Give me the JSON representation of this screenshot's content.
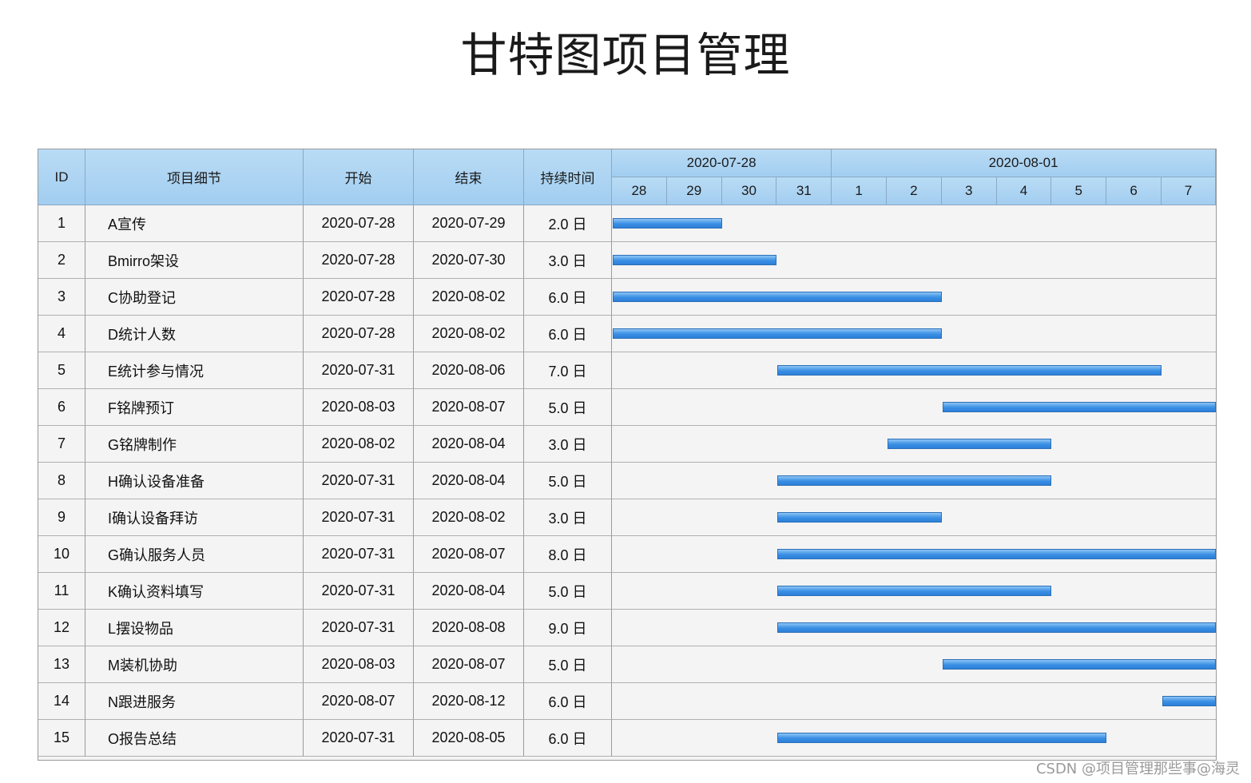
{
  "title": "甘特图项目管理",
  "columns": {
    "id": "ID",
    "detail": "项目细节",
    "start": "开始",
    "end": "结束",
    "duration": "持续时间"
  },
  "timeline": {
    "groups": [
      {
        "label": "2020-07-28",
        "days": 4
      },
      {
        "label": "2020-08-01",
        "days": 7
      }
    ],
    "day_labels": [
      "28",
      "29",
      "30",
      "31",
      "1",
      "2",
      "3",
      "4",
      "5",
      "6",
      "7"
    ],
    "start_date": "2020-07-28"
  },
  "colors": {
    "header": "#a8d1f1",
    "bar": "#3a8fe4",
    "bar_border": "#2c6fb7",
    "row_bg": "#f4f4f4"
  },
  "tasks": [
    {
      "id": "1",
      "name": "A宣传",
      "start": "2020-07-28",
      "end": "2020-07-29",
      "duration": "2.0 日"
    },
    {
      "id": "2",
      "name": "Bmirro架设",
      "start": "2020-07-28",
      "end": "2020-07-30",
      "duration": "3.0 日"
    },
    {
      "id": "3",
      "name": "C协助登记",
      "start": "2020-07-28",
      "end": "2020-08-02",
      "duration": "6.0 日"
    },
    {
      "id": "4",
      "name": "D统计人数",
      "start": "2020-07-28",
      "end": "2020-08-02",
      "duration": "6.0 日"
    },
    {
      "id": "5",
      "name": "E统计参与情况",
      "start": "2020-07-31",
      "end": "2020-08-06",
      "duration": "7.0 日"
    },
    {
      "id": "6",
      "name": "F铭牌预订",
      "start": "2020-08-03",
      "end": "2020-08-07",
      "duration": "5.0 日"
    },
    {
      "id": "7",
      "name": "G铭牌制作",
      "start": "2020-08-02",
      "end": "2020-08-04",
      "duration": "3.0 日"
    },
    {
      "id": "8",
      "name": "H确认设备准备",
      "start": "2020-07-31",
      "end": "2020-08-04",
      "duration": "5.0 日"
    },
    {
      "id": "9",
      "name": "I确认设备拜访",
      "start": "2020-07-31",
      "end": "2020-08-02",
      "duration": "3.0 日"
    },
    {
      "id": "10",
      "name": "G确认服务人员",
      "start": "2020-07-31",
      "end": "2020-08-07",
      "duration": "8.0 日"
    },
    {
      "id": "11",
      "name": "K确认资料填写",
      "start": "2020-07-31",
      "end": "2020-08-04",
      "duration": "5.0 日"
    },
    {
      "id": "12",
      "name": "L摆设物品",
      "start": "2020-07-31",
      "end": "2020-08-08",
      "duration": "9.0 日"
    },
    {
      "id": "13",
      "name": "M装机协助",
      "start": "2020-08-03",
      "end": "2020-08-07",
      "duration": "5.0 日"
    },
    {
      "id": "14",
      "name": "N跟进服务",
      "start": "2020-08-07",
      "end": "2020-08-12",
      "duration": "6.0 日"
    },
    {
      "id": "15",
      "name": "O报告总结",
      "start": "2020-07-31",
      "end": "2020-08-05",
      "duration": "6.0 日"
    }
  ],
  "watermark": "CSDN @项目管理那些事@海灵"
}
